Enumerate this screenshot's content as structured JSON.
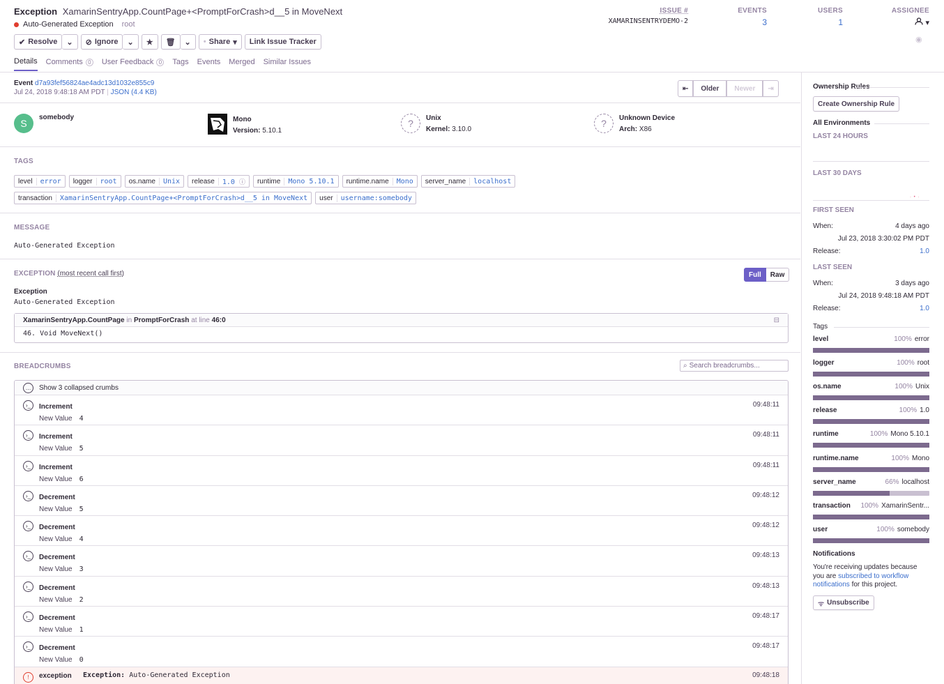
{
  "header": {
    "type": "Exception",
    "culprit": "XamarinSentryApp.CountPage+<PromptForCrash>d__5 in MoveNext",
    "message": "Auto-Generated Exception",
    "logger": "root",
    "issue_label": "ISSUE #",
    "issue_id": "XAMARINSENTRYDEMO-2",
    "events_label": "EVENTS",
    "events_value": "3",
    "users_label": "USERS",
    "users_value": "1",
    "assignee_label": "ASSIGNEE"
  },
  "toolbar": {
    "resolve": "Resolve",
    "ignore": "Ignore",
    "share": "Share",
    "link_tracker": "Link Issue Tracker"
  },
  "tabs": [
    {
      "label": "Details"
    },
    {
      "label": "Comments",
      "count": "0"
    },
    {
      "label": "User Feedback",
      "count": "0"
    },
    {
      "label": "Tags"
    },
    {
      "label": "Events"
    },
    {
      "label": "Merged"
    },
    {
      "label": "Similar Issues"
    }
  ],
  "event": {
    "label": "Event",
    "id": "d7a93fef56824ae4adc13d1032e855c9",
    "date": "Jul 24, 2018 9:48:18 AM PDT",
    "json_link": "JSON (4.4 KB)",
    "older": "Older",
    "newer": "Newer"
  },
  "contexts": [
    {
      "name": "somebody",
      "sub": "",
      "initial": "S"
    },
    {
      "name": "Mono",
      "sub_label": "Version:",
      "sub_value": "5.10.1"
    },
    {
      "name": "Unix",
      "sub_label": "Kernel:",
      "sub_value": "3.10.0"
    },
    {
      "name": "Unknown Device",
      "sub_label": "Arch:",
      "sub_value": "X86"
    }
  ],
  "tags_title": "TAGS",
  "tags_row1": [
    {
      "k": "level",
      "v": "error"
    },
    {
      "k": "logger",
      "v": "root"
    },
    {
      "k": "os.name",
      "v": "Unix"
    },
    {
      "k": "release",
      "v": "1.0"
    },
    {
      "k": "runtime",
      "v": "Mono 5.10.1"
    },
    {
      "k": "runtime.name",
      "v": "Mono"
    },
    {
      "k": "server_name",
      "v": "localhost"
    }
  ],
  "tags_row2": [
    {
      "k": "transaction",
      "v": "XamarinSentryApp.CountPage+<PromptForCrash>d__5 in MoveNext"
    },
    {
      "k": "user",
      "v": "username:somebody"
    }
  ],
  "message_section": {
    "title": "MESSAGE",
    "text": "Auto-Generated Exception"
  },
  "exception_section": {
    "title": "EXCEPTION",
    "title_note": "(most recent call first)",
    "full": "Full",
    "raw": "Raw",
    "type": "Exception",
    "value": "Auto-Generated Exception",
    "frame_module": "XamarinSentryApp.CountPage",
    "frame_in": "in",
    "frame_function": "PromptForCrash",
    "frame_at": "at line",
    "frame_line": "46:0",
    "frame_code": "46.  Void MoveNext()"
  },
  "breadcrumbs": {
    "title": "BREADCRUMBS",
    "search_placeholder": "Search breadcrumbs...",
    "collapsed": "Show 3 collapsed crumbs",
    "items": [
      {
        "cat": "Increment",
        "k": "New Value",
        "v": "4",
        "time": "09:48:11"
      },
      {
        "cat": "Increment",
        "k": "New Value",
        "v": "5",
        "time": "09:48:11"
      },
      {
        "cat": "Increment",
        "k": "New Value",
        "v": "6",
        "time": "09:48:11"
      },
      {
        "cat": "Decrement",
        "k": "New Value",
        "v": "5",
        "time": "09:48:12"
      },
      {
        "cat": "Decrement",
        "k": "New Value",
        "v": "4",
        "time": "09:48:12"
      },
      {
        "cat": "Decrement",
        "k": "New Value",
        "v": "3",
        "time": "09:48:13"
      },
      {
        "cat": "Decrement",
        "k": "New Value",
        "v": "2",
        "time": "09:48:13"
      },
      {
        "cat": "Decrement",
        "k": "New Value",
        "v": "1",
        "time": "09:48:17"
      },
      {
        "cat": "Decrement",
        "k": "New Value",
        "v": "0",
        "time": "09:48:17"
      }
    ],
    "error": {
      "cat": "exception",
      "msg_type": "Exception:",
      "msg": "Auto-Generated Exception",
      "time": "09:48:18"
    }
  },
  "sidebar": {
    "ownership_title": "Ownership Rules",
    "create_rule": "Create Ownership Rule",
    "all_env": "All Environments",
    "last24": "LAST 24 HOURS",
    "last30": "LAST 30 DAYS",
    "first_seen": "FIRST SEEN",
    "first_when_label": "When:",
    "first_when": "4 days ago",
    "first_date": "Jul 23, 2018 3:30:02 PM PDT",
    "first_release_label": "Release:",
    "first_release": "1.0",
    "last_seen": "LAST SEEN",
    "last_when_label": "When:",
    "last_when": "3 days ago",
    "last_date": "Jul 24, 2018 9:48:18 AM PDT",
    "last_release_label": "Release:",
    "last_release": "1.0",
    "tags_title": "Tags",
    "tags": [
      {
        "k": "level",
        "pct": "100%",
        "v": "error",
        "share": 1.0
      },
      {
        "k": "logger",
        "pct": "100%",
        "v": "root",
        "share": 1.0
      },
      {
        "k": "os.name",
        "pct": "100%",
        "v": "Unix",
        "share": 1.0
      },
      {
        "k": "release",
        "pct": "100%",
        "v": "1.0",
        "share": 1.0
      },
      {
        "k": "runtime",
        "pct": "100%",
        "v": "Mono 5.10.1",
        "share": 1.0
      },
      {
        "k": "runtime.name",
        "pct": "100%",
        "v": "Mono",
        "share": 1.0
      },
      {
        "k": "server_name",
        "pct": "66%",
        "v": "localhost",
        "share": 0.66
      },
      {
        "k": "transaction",
        "pct": "100%",
        "v": "XamarinSentr...",
        "share": 1.0
      },
      {
        "k": "user",
        "pct": "100%",
        "v": "somebody",
        "share": 1.0
      }
    ],
    "notifications_title": "Notifications",
    "notif_text1": "You're receiving updates because you are",
    "notif_link": "subscribed to workflow notifications",
    "notif_text2": "for this project.",
    "unsubscribe": "Unsubscribe"
  }
}
